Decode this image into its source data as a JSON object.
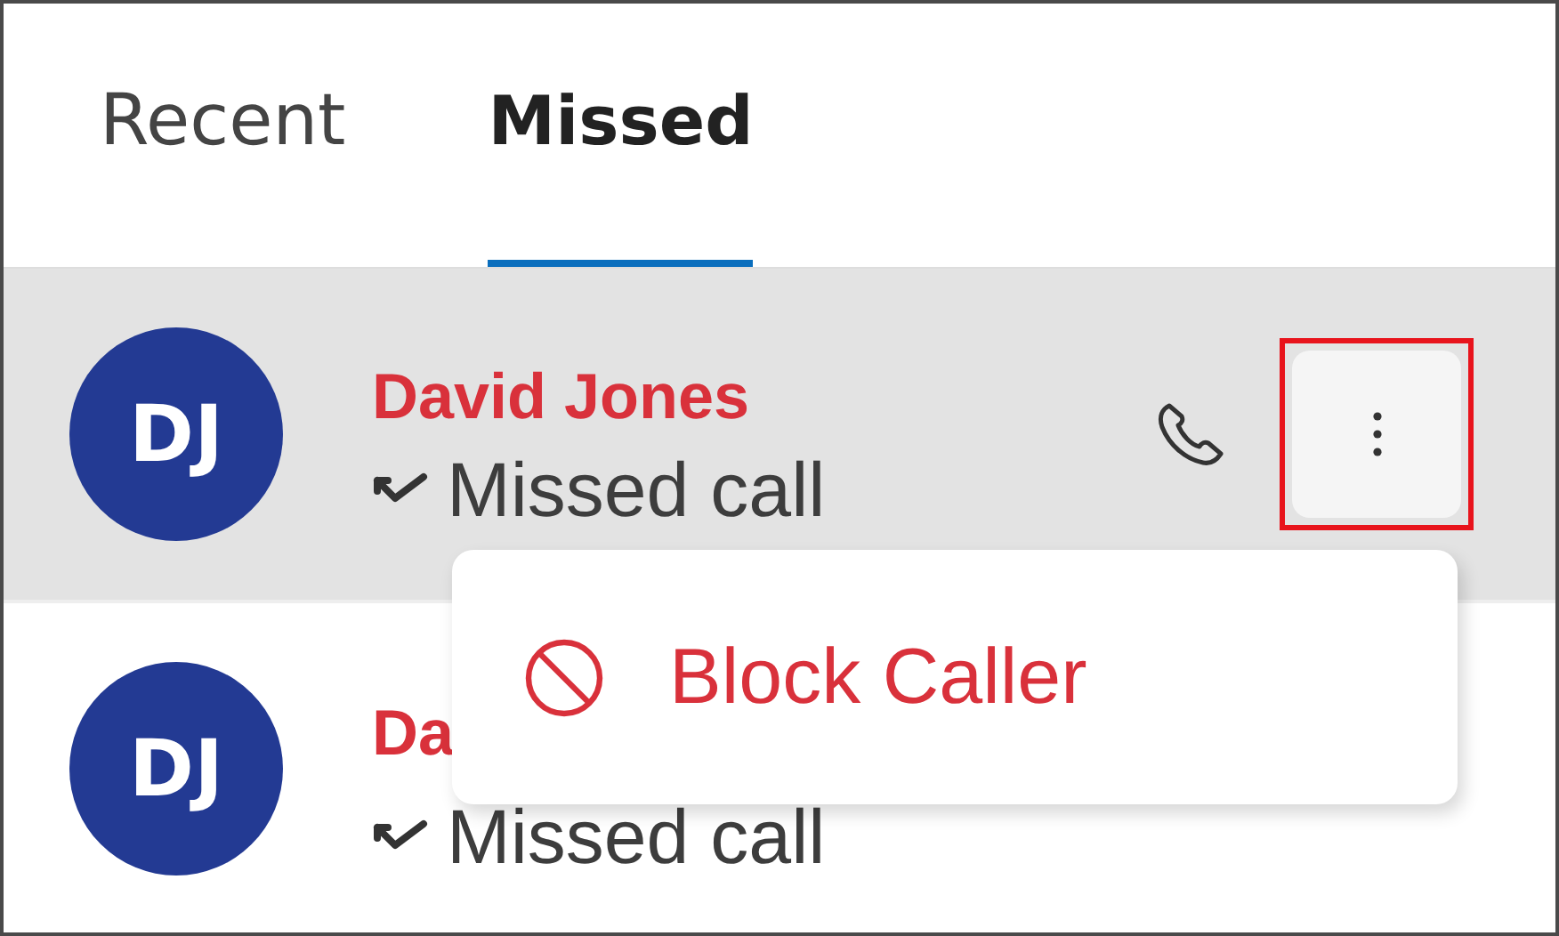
{
  "tabs": [
    {
      "label": "Recent",
      "selected": false
    },
    {
      "label": "Missed",
      "selected": true
    }
  ],
  "calls": [
    {
      "initials": "DJ",
      "name": "David Jones",
      "status": "Missed call",
      "selected": true,
      "more_highlighted": true
    },
    {
      "initials": "DJ",
      "name": "Da",
      "status": "Missed call",
      "selected": false,
      "more_highlighted": false
    }
  ],
  "menu": {
    "open": true,
    "items": [
      {
        "label": "Block Caller"
      }
    ]
  }
}
